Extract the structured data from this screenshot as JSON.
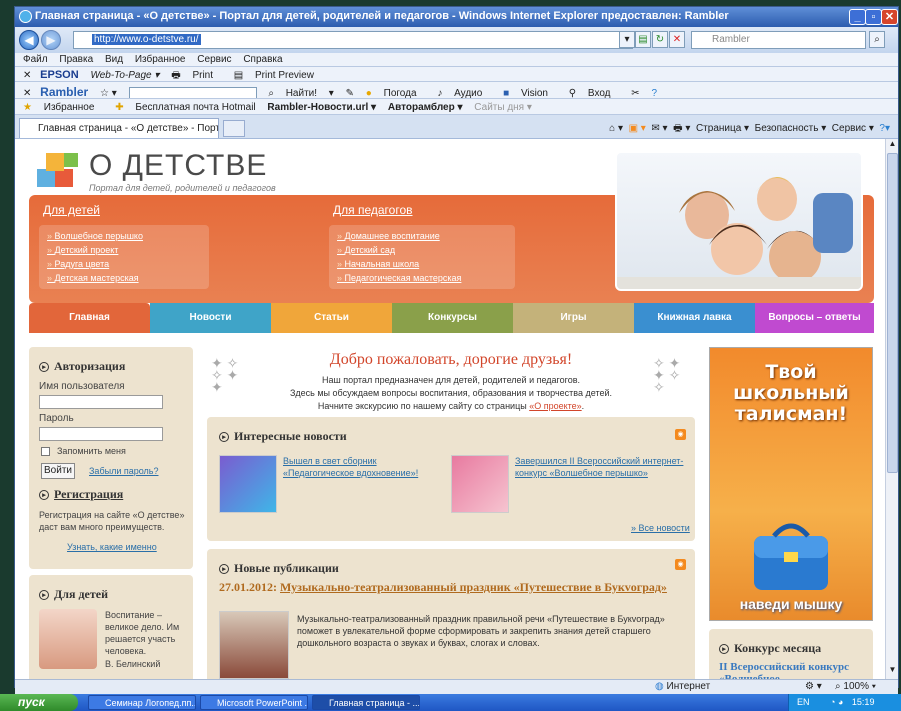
{
  "window": {
    "title": "Главная страница - «О детстве» - Портал для детей, родителей и педагогов - Windows Internet Explorer предоставлен: Rambler"
  },
  "address": {
    "url": "http://www.o-detstve.ru/",
    "search_placeholder": "Rambler"
  },
  "menubar": [
    "Файл",
    "Правка",
    "Вид",
    "Избранное",
    "Сервис",
    "Справка"
  ],
  "epson_bar": {
    "brand": "EPSON",
    "web_to_page": "Web-To-Page ▾",
    "print": "Print",
    "print_preview": "Print Preview"
  },
  "rambler_bar": {
    "brand": "Rambler",
    "find": "Найти!",
    "weather": "Погода",
    "audio": "Аудио",
    "vision": "Vision",
    "login": "Вход"
  },
  "favorites_bar": {
    "favorites": "Избранное",
    "items": [
      "Бесплатная почта Hotmail",
      "Rambler-Новости.url ▾",
      "Авторамблер ▾",
      "Сайты дня ▾"
    ]
  },
  "tab": {
    "title": "Главная страница - «О детстве» - Портал для дет..."
  },
  "toolbar_right": {
    "page": "Страница ▾",
    "security": "Безопасность ▾",
    "service": "Сервис ▾"
  },
  "site": {
    "logo_title": "О ДЕТСТВЕ",
    "logo_subtitle": "Портал для детей, родителей и педагогов",
    "menu_children": {
      "title": "Для детей",
      "items": [
        "Волшебное перышко",
        "Детский проект",
        "Радуга цвета",
        "Детская мастерская"
      ]
    },
    "menu_teachers": {
      "title": "Для педагогов",
      "items": [
        "Домашнее воспитание",
        "Детский сад",
        "Начальная школа",
        "Педагогическая мастерская"
      ]
    },
    "nav": [
      {
        "label": "Главная",
        "color": "#e2663a"
      },
      {
        "label": "Новости",
        "color": "#3fa4c8"
      },
      {
        "label": "Статьи",
        "color": "#f0a63a"
      },
      {
        "label": "Конкурсы",
        "color": "#8aa04a"
      },
      {
        "label": "Игры",
        "color": "#c4b27a"
      },
      {
        "label": "Книжная лавка",
        "color": "#3a8fd0"
      },
      {
        "label": "Вопросы – ответы",
        "color": "#c04ad0"
      }
    ],
    "auth": {
      "title": "Авторизация",
      "username_label": "Имя пользователя",
      "password_label": "Пароль",
      "remember": "Запомнить меня",
      "login_button": "Войти",
      "forgot": "Забыли пароль?",
      "register_title": "Регистрация",
      "register_text": "Регистрация на сайте «О детстве» даст вам много преимуществ.",
      "register_link": "Узнать, какие именно"
    },
    "kids": {
      "title": "Для детей",
      "quote": "Воспитание – великое дело. Им решается участь человека.",
      "author": "В. Белинский"
    },
    "welcome": {
      "title": "Добро пожаловать, дорогие друзья!",
      "line1": "Наш портал предназначен для детей, родителей и педагогов.",
      "line2": "Здесь мы обсуждаем вопросы воспитания, образования и творчества детей.",
      "line3_prefix": "Начните экскурсию по нашему сайту со страницы ",
      "line3_link": "«О проекте»",
      "line3_suffix": "."
    },
    "news": {
      "title": "Интересные новости",
      "item1": "Вышел в свет сборник «Педагогическое вдохновение»!",
      "item2": "Завершился II Всероссийский интернет-конкурс «Волшебное перышко»",
      "all": "» Все новости"
    },
    "pubs": {
      "title": "Новые публикации",
      "date": "27.01.2012:",
      "headline": "Музыкально-театрализованный праздник «Путешествие в Букvоград»",
      "text": "Музыкально-театрализованный праздник правильной речи «Путешествие в Букvоград» поможет в увлекательной форме сформировать и закрепить знания детей старшего дошкольного возраста о звуках и буквах, слогах и словах."
    },
    "ad": {
      "line1": "Твой",
      "line2": "школьный",
      "line3": "талисман!",
      "cta": "наведи мышку"
    },
    "contest": {
      "title": "Конкурс месяца",
      "text": "II Всероссийский конкурс «Волшебное"
    }
  },
  "statusbar": {
    "zone": "Интернет",
    "zoom": "100%"
  },
  "taskbar": {
    "start": "пуск",
    "tasks": [
      "Семинар Логопед.пп...",
      "Microsoft PowerPoint ...",
      "Главная страница - ..."
    ],
    "lang": "EN",
    "time": "15:19"
  }
}
